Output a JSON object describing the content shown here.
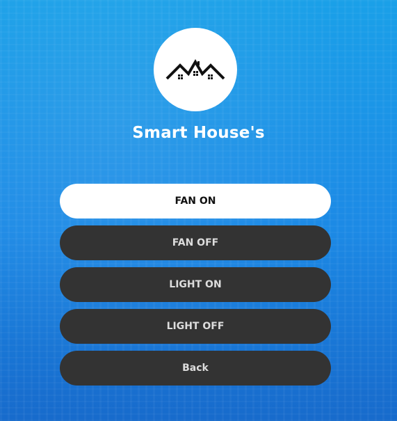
{
  "app": {
    "title": "Smart House's",
    "logo_icon": "houses-roof-icon"
  },
  "buttons": {
    "fan_on": "FAN ON",
    "fan_off": "FAN OFF",
    "light_on": "LIGHT ON",
    "light_off": "LIGHT OFF",
    "back": "Back"
  },
  "colors": {
    "background_top": "#1aa0e8",
    "background_bottom": "#1a79e0",
    "button_active_bg": "#ffffff",
    "button_bg": "#333333",
    "button_text": "#dddddd"
  }
}
